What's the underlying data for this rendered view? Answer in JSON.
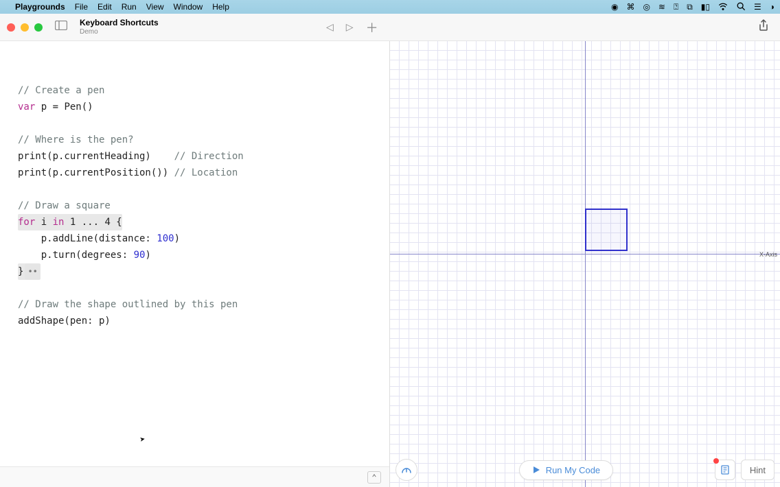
{
  "menubar": {
    "app": "Playgrounds",
    "items": [
      "File",
      "Edit",
      "Run",
      "View",
      "Window",
      "Help"
    ]
  },
  "window": {
    "title": "Keyboard Shortcuts",
    "subtitle": "Demo"
  },
  "code": {
    "l1": "// Create a pen",
    "l2a": "var",
    "l2b": " p = Pen()",
    "l3": "// Where is the pen?",
    "l4a": "print(p.currentHeading)    ",
    "l4b": "// Direction",
    "l5a": "print(p.currentPosition()) ",
    "l5b": "// Location",
    "l6": "// Draw a square",
    "l7a": "for",
    "l7b": " i ",
    "l7c": "in",
    "l7d": " 1 ... 4 {",
    "l8a": "    p.addLine(distance: ",
    "l8b": "100",
    "l8c": ")",
    "l9a": "    p.turn(degrees: ",
    "l9b": "90",
    "l9c": ")",
    "l10": "}",
    "l11": "// Draw the shape outlined by this pen",
    "l12": "addShape(pen: p)",
    "fold": "••"
  },
  "liveview": {
    "x_axis_label": "X-Axis",
    "run_label": "Run My Code",
    "hint_label": "Hint"
  },
  "colors": {
    "accent": "#4a8cd8",
    "shape": "#3030cc"
  }
}
